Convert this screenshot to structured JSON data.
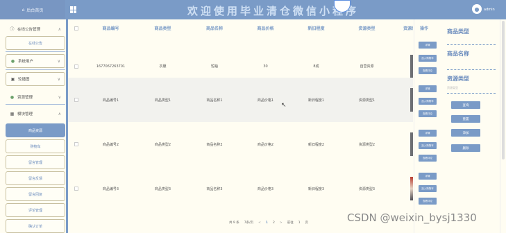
{
  "header": {
    "home_label": "后台首页",
    "title": "欢迎使用毕业清仓微信小程序",
    "user": "admin",
    "avatar_glyph": "●"
  },
  "sidebar": {
    "items": [
      {
        "label": "在线公告管理",
        "type": "category",
        "arrow": "∧"
      },
      {
        "label": "在线公告",
        "type": "sub"
      },
      {
        "label": "系统用户",
        "type": "category",
        "arrow": "∨"
      },
      {
        "label": "轮播图",
        "type": "category",
        "arrow": "∨"
      },
      {
        "label": "资源管理",
        "type": "category",
        "arrow": "∨"
      },
      {
        "label": "模块管理",
        "type": "category",
        "arrow": "∧"
      },
      {
        "label": "商品资源",
        "type": "sub",
        "active": true
      },
      {
        "label": "购物车",
        "type": "sub"
      },
      {
        "label": "留言管理",
        "type": "sub"
      },
      {
        "label": "留言反馈",
        "type": "sub"
      },
      {
        "label": "留言回复",
        "type": "sub"
      },
      {
        "label": "评论管理",
        "type": "sub"
      },
      {
        "label": "确认订单",
        "type": "sub"
      }
    ]
  },
  "table": {
    "headers": [
      "商品编号",
      "商品类型",
      "商品名称",
      "商品价格",
      "新旧程度",
      "资源类型",
      "资源图"
    ],
    "rows": [
      [
        "1677067263701",
        "衣服",
        "短袖",
        "30",
        "8成",
        "自营资源"
      ],
      [
        "商品编号1",
        "商品类型1",
        "商品名称1",
        "商品价格1",
        "新旧程度1",
        "资源类型1"
      ],
      [
        "商品编号2",
        "商品类型2",
        "商品名称2",
        "商品价格2",
        "新旧程度2",
        "资源类型2"
      ],
      [
        "商品编号3",
        "商品类型3",
        "商品名称3",
        "商品价格3",
        "新旧程度3",
        "资源类型3"
      ]
    ]
  },
  "pagination": {
    "total": "共 9 条",
    "page_size": "7条/页",
    "prev": "<",
    "pages": [
      "1",
      "2"
    ],
    "next": ">",
    "goto": "前往",
    "goto_value": "1",
    "page_unit": "页"
  },
  "operations": {
    "header": "操作",
    "buttons": [
      "详情",
      "加入购物车",
      "查看评论"
    ]
  },
  "search": {
    "fields": [
      "商品类型",
      "商品名称",
      "资源类型"
    ],
    "resource_placeholder": "资源类型",
    "buttons": [
      "查询",
      "重置",
      "添加",
      "删除"
    ]
  },
  "watermark": "CSDN @weixin_bysj1330",
  "colors": {
    "accent": "#7a9bc7",
    "background": "#fffdf2"
  }
}
